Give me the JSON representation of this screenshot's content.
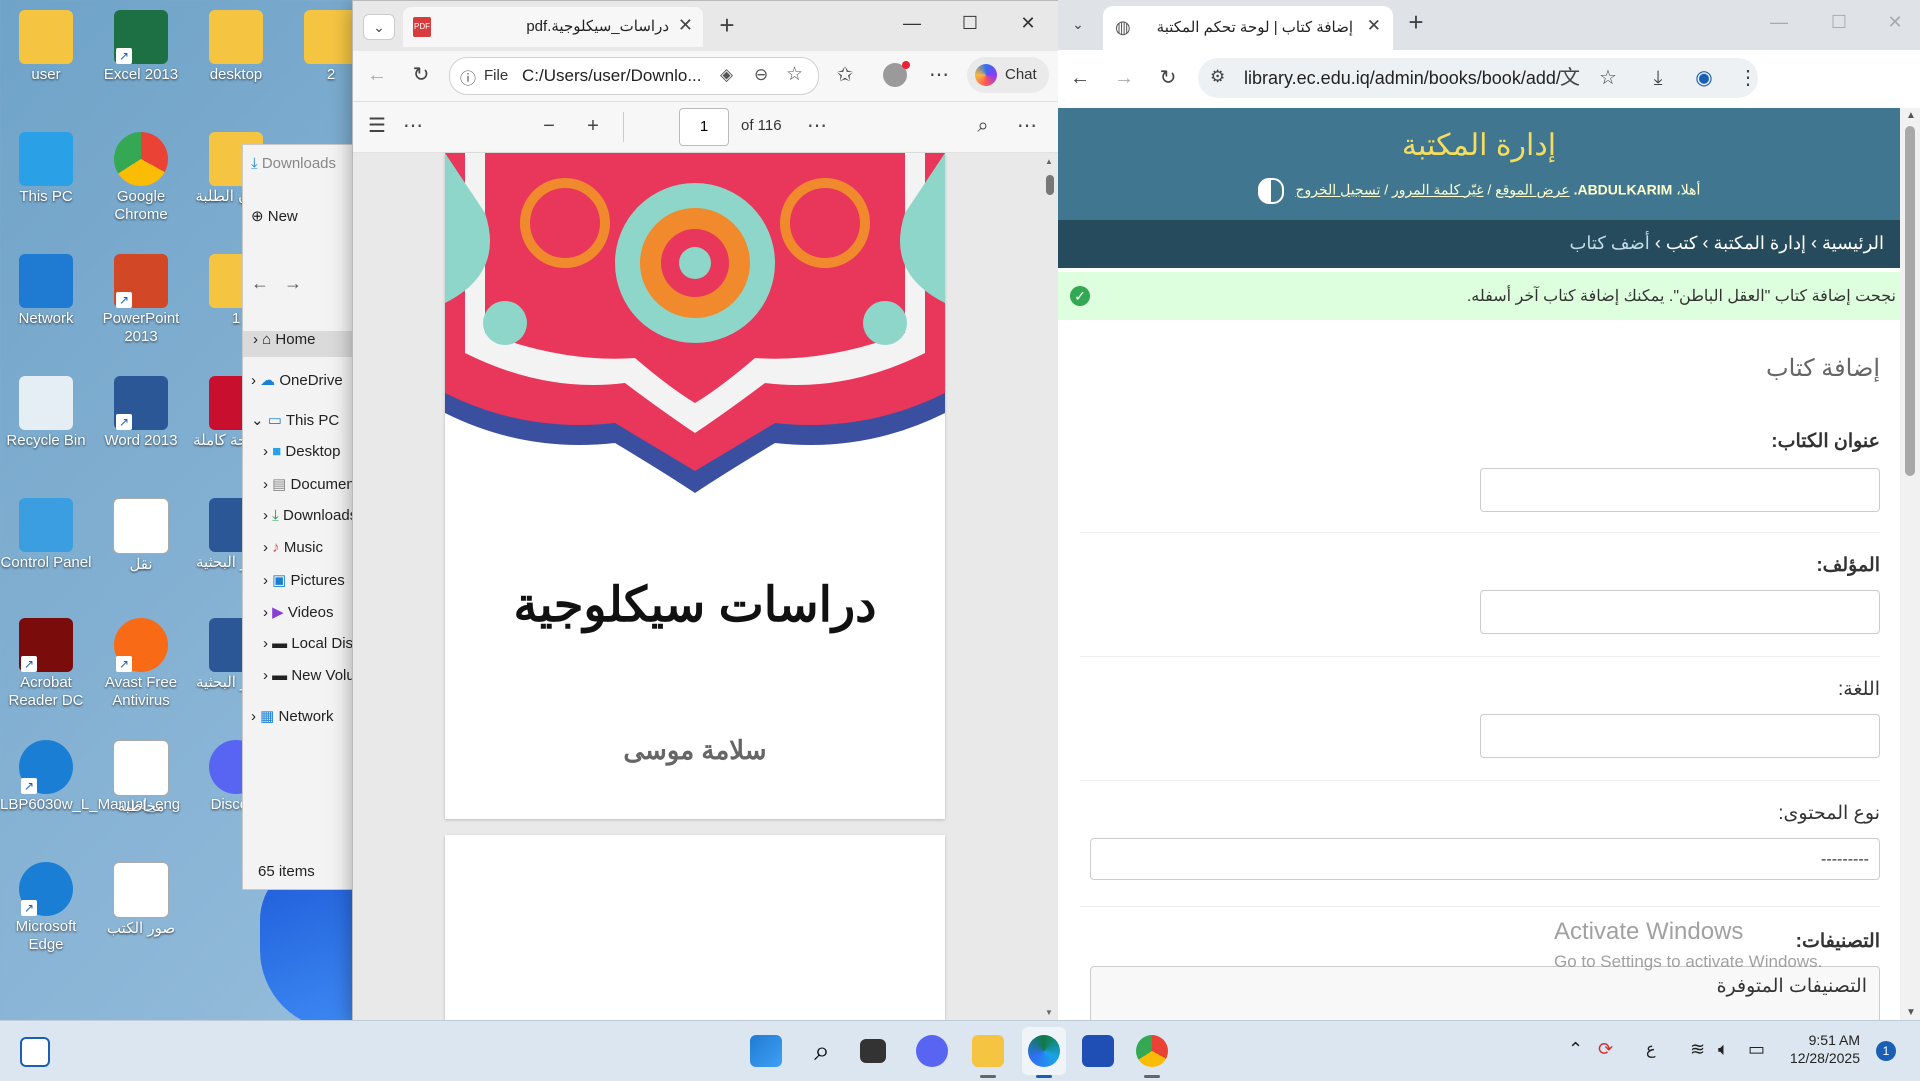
{
  "desktop": {
    "icons": [
      {
        "label": "user"
      },
      {
        "label": "Excel 2013"
      },
      {
        "label": "desktop"
      },
      {
        "label": "2"
      },
      {
        "label": "This PC"
      },
      {
        "label": "Google Chrome"
      },
      {
        "label": "شؤون الطلبة"
      },
      {
        "label": "Network"
      },
      {
        "label": "PowerPoint 2013"
      },
      {
        "label": "1"
      },
      {
        "label": "Recycle Bin"
      },
      {
        "label": "Word 2013"
      },
      {
        "label": "أطروحة كاملة"
      },
      {
        "label": "Control Panel"
      },
      {
        "label": "نقل"
      },
      {
        "label": "مراكز البحثية"
      },
      {
        "label": "Acrobat Reader DC"
      },
      {
        "label": "Avast Free Antivirus"
      },
      {
        "label": "مراكز البحثية"
      },
      {
        "label": "LBP6030w_L_Manual_eng"
      },
      {
        "label": "مخاطبة"
      },
      {
        "label": "Discord"
      },
      {
        "label": "Microsoft Edge"
      },
      {
        "label": "صور الكتب"
      }
    ]
  },
  "explorer": {
    "header": "Downloads",
    "new_label": "New",
    "nav": [
      "Home",
      "OneDrive",
      "This PC",
      "Desktop",
      "Documents",
      "Downloads",
      "Music",
      "Pictures",
      "Videos",
      "Local Disk",
      "New Volume",
      "Network"
    ],
    "status": "65 items"
  },
  "edge": {
    "tab_title": "دراسات_سيكلوجية.pdf",
    "address_prefix": "File",
    "address": "C:/Users/user/Downlo...",
    "chat_label": "Chat",
    "page_current": "1",
    "page_total": "of 116",
    "book_title": "دراسات سيكلوجية",
    "book_author": "سلامة موسى"
  },
  "chrome": {
    "tab_title": "إضافة كتاب | لوحة تحكم المكتبة",
    "url": "library.ec.edu.iq/admin/books/book/add/",
    "site_title": "إدارة المكتبة",
    "user_links": {
      "welcome": "أهلا،",
      "user": "ABDULKARIM.",
      "view_site": "عرض الموقع",
      "change_password": "غيّر كلمة المرور",
      "logout": "تسجيل الخروج"
    },
    "breadcrumb": {
      "home": "الرئيسية",
      "admin": "إدارة المكتبة",
      "books": "كتب",
      "current": "أضف كتاب"
    },
    "message": "نجحت إضافة كتاب \"العقل الباطن\". يمكنك إضافة كتاب آخر أسفله.",
    "page_heading": "إضافة كتاب",
    "fields": [
      {
        "label": "عنوان الكتاب:",
        "value": ""
      },
      {
        "label": "المؤلف:",
        "value": ""
      },
      {
        "label": "اللغة:",
        "value": ""
      },
      {
        "label": "نوع المحتوى:",
        "value": "---------"
      },
      {
        "label": "التصنيفات:",
        "value": "التصنيفات المتوفرة"
      }
    ],
    "watermark_title": "Activate Windows",
    "watermark_sub": "Go to Settings to activate Windows."
  },
  "taskbar": {
    "time": "9:51 AM",
    "date": "12/28/2025",
    "lang": "ع",
    "notification_count": "1"
  }
}
